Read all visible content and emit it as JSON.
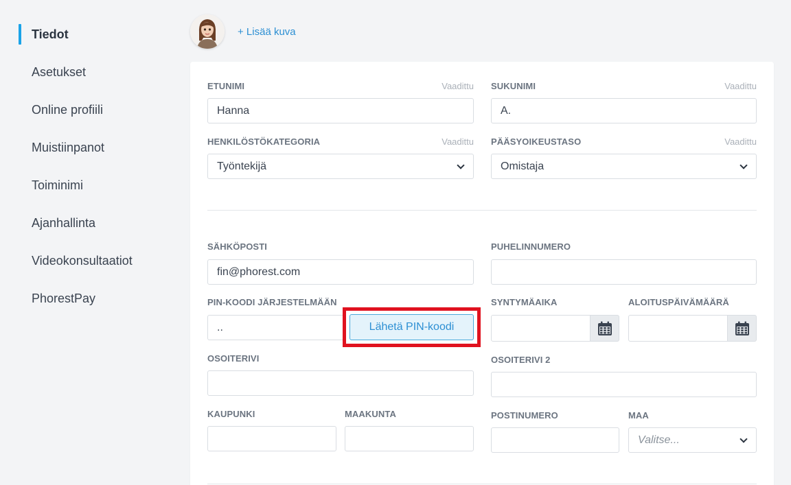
{
  "sidebar": {
    "items": [
      {
        "label": "Tiedot",
        "active": true
      },
      {
        "label": "Asetukset"
      },
      {
        "label": "Online profiili"
      },
      {
        "label": "Muistiinpanot"
      },
      {
        "label": "Toiminimi"
      },
      {
        "label": "Ajanhallinta"
      },
      {
        "label": "Videokonsultaatiot"
      },
      {
        "label": "PhorestPay"
      }
    ]
  },
  "header": {
    "add_photo": "+ Lisää kuva"
  },
  "form": {
    "required": "Vaadittu",
    "first_name": {
      "label": "ETUNIMI",
      "value": "Hanna"
    },
    "last_name": {
      "label": "SUKUNIMI",
      "value": "A."
    },
    "staff_category": {
      "label": "HENKILÖSTÖKATEGORIA",
      "value": "Työntekijä"
    },
    "access_level": {
      "label": "PÄÄSYOIKEUSTASO",
      "value": "Omistaja"
    },
    "email": {
      "label": "SÄHKÖPOSTI",
      "value": "fin@phorest.com"
    },
    "phone": {
      "label": "PUHELINNUMERO",
      "value": ""
    },
    "pin": {
      "label": "PIN-KOODI JÄRJESTELMÄÄN",
      "value": "..",
      "button": "Lähetä PIN-koodi"
    },
    "birthday": {
      "label": "SYNTYMÄAIKA",
      "value": ""
    },
    "start_date": {
      "label": "ALOITUSPÄIVÄMÄÄRÄ",
      "value": ""
    },
    "address1": {
      "label": "OSOITERIVI",
      "value": ""
    },
    "address2": {
      "label": "OSOITERIVI 2",
      "value": ""
    },
    "city": {
      "label": "KAUPUNKI",
      "value": ""
    },
    "county": {
      "label": "MAAKUNTA",
      "value": ""
    },
    "postcode": {
      "label": "POSTINUMERO",
      "value": ""
    },
    "country": {
      "label": "MAA",
      "placeholder": "Valitse..."
    }
  },
  "colors": {
    "accent": "#1aa3e8",
    "link": "#2c8fd3",
    "highlight": "#e0121f"
  }
}
